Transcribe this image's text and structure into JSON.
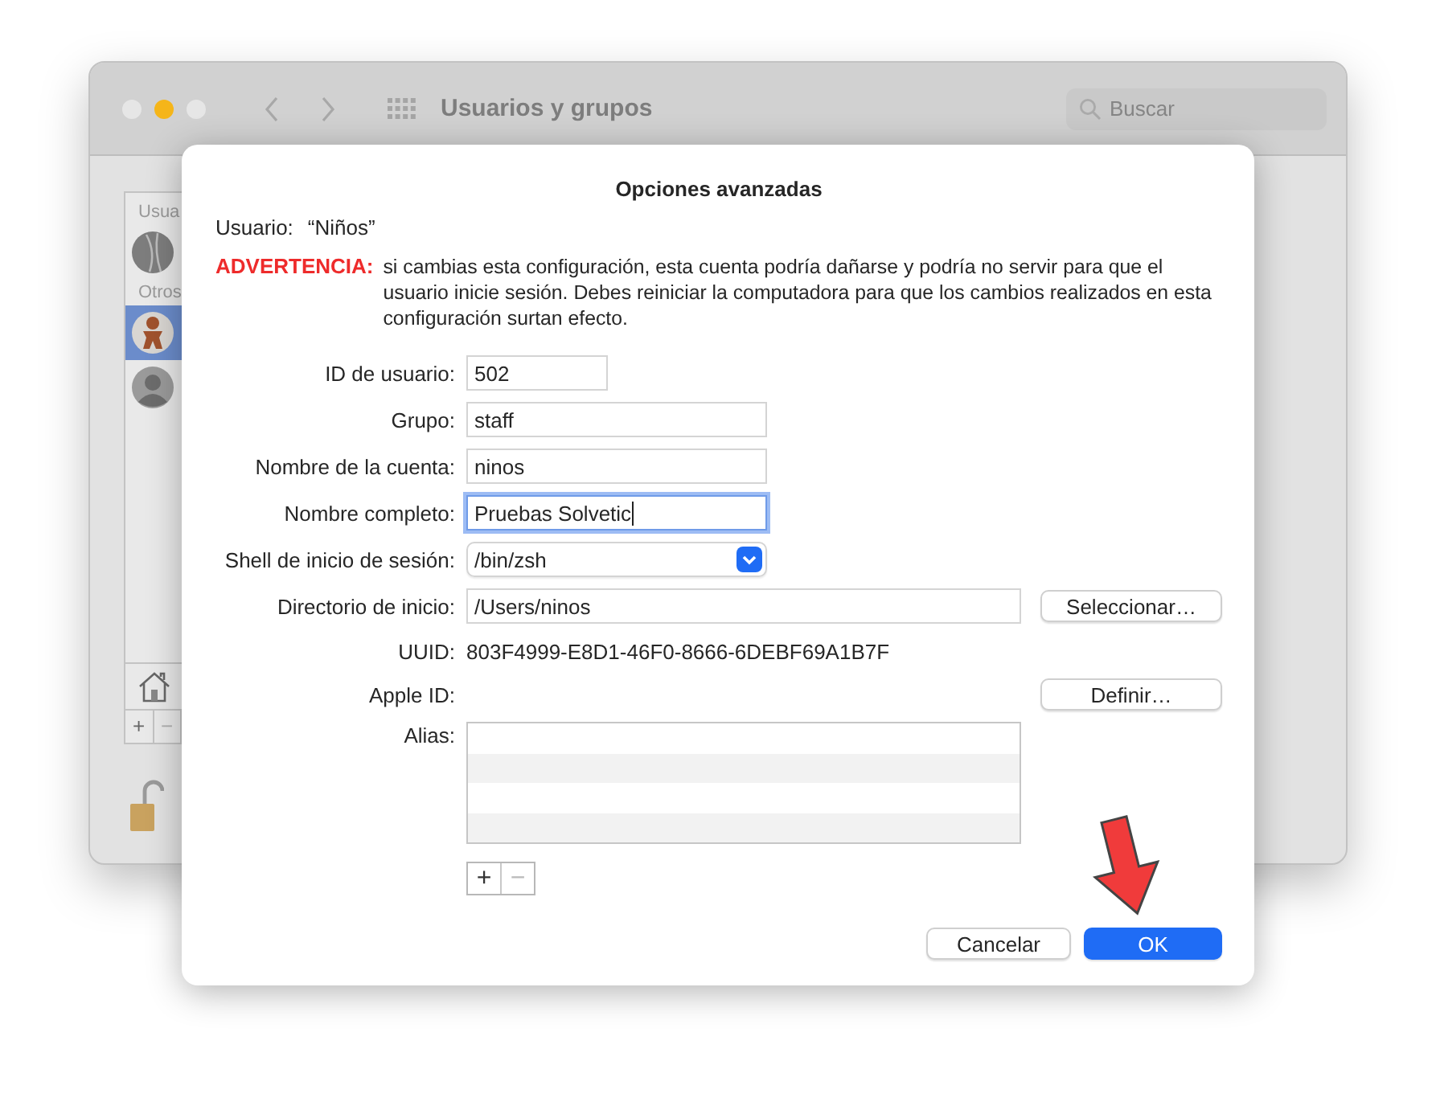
{
  "window": {
    "title": "Usuarios y grupos",
    "search": {
      "placeholder": "Buscar"
    }
  },
  "sidebar": {
    "items": [
      {
        "kind": "header",
        "label": "Usua"
      },
      {
        "kind": "user",
        "selected": false
      },
      {
        "kind": "header",
        "label": "Otros"
      },
      {
        "kind": "user",
        "selected": true
      },
      {
        "kind": "user",
        "selected": false
      }
    ],
    "buttons": [
      {
        "label": "+",
        "disabled": false
      },
      {
        "label": "−",
        "disabled": true
      }
    ]
  },
  "sheet": {
    "title": "Opciones avanzadas",
    "user_label": "Usuario:",
    "user_value": "“Niños”",
    "warning": {
      "label": "ADVERTENCIA:",
      "text": "si cambias esta configuración, esta cuenta podría dañarse y podría no servir para que el usuario inicie sesión. Debes reiniciar la computadora para que los cambios realizados en esta configuración surtan efecto."
    },
    "fields": [
      {
        "kind": "number",
        "label": "ID de usuario:",
        "value": "502",
        "focused": false
      },
      {
        "kind": "text",
        "label": "Grupo:",
        "value": "staff",
        "focused": false
      },
      {
        "kind": "text",
        "label": "Nombre de la cuenta:",
        "value": "ninos",
        "focused": false
      },
      {
        "kind": "text",
        "label": "Nombre completo:",
        "value": "Pruebas Solvetic",
        "focused": true
      },
      {
        "kind": "popup",
        "label": "Shell de inicio de sesión:",
        "value": "/bin/zsh"
      },
      {
        "kind": "path",
        "label": "Directorio de inicio:",
        "value": "/Users/ninos",
        "button": "Seleccionar…"
      },
      {
        "kind": "static",
        "label": "UUID:",
        "value": "803F4999-E8D1-46F0-8666-6DEBF69A1B7F"
      },
      {
        "kind": "action",
        "label": "Apple ID:",
        "button": "Definir…"
      },
      {
        "kind": "list",
        "label": "Alias:"
      }
    ],
    "list_buttons": [
      {
        "label": "+",
        "disabled": false
      },
      {
        "label": "−",
        "disabled": true
      }
    ],
    "buttons": [
      {
        "label": "Cancelar",
        "default": false
      },
      {
        "label": "OK",
        "default": true
      }
    ]
  }
}
